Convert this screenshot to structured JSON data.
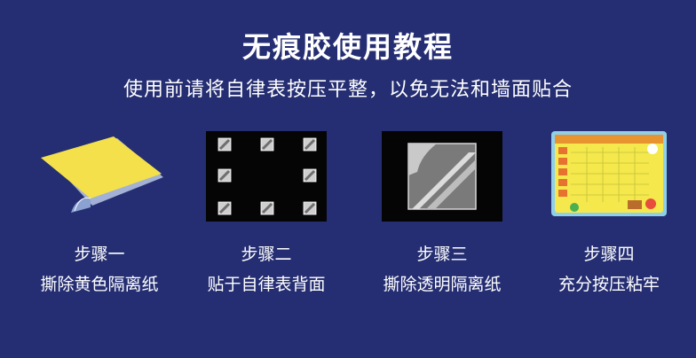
{
  "header": {
    "title": "无痕胶使用教程",
    "subtitle": "使用前请将自律表按压平整，以免无法和墙面贴合"
  },
  "steps": [
    {
      "label": "步骤一",
      "desc": "撕除黄色隔离纸",
      "icon": "adhesive-sheet-icon"
    },
    {
      "label": "步骤二",
      "desc": "贴于自律表背面",
      "icon": "adhesive-dots-icon"
    },
    {
      "label": "步骤三",
      "desc": "撕除透明隔离纸",
      "icon": "peel-film-icon"
    },
    {
      "label": "步骤四",
      "desc": "充分按压粘牢",
      "icon": "chart-board-icon"
    }
  ],
  "colors": {
    "background": "#252e72",
    "accent_yellow": "#f3e04a"
  }
}
